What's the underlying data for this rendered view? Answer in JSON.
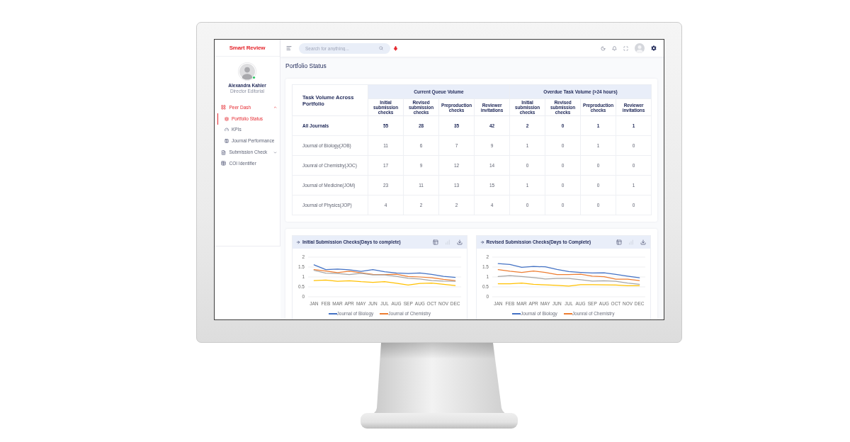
{
  "app": {
    "name": "Smart Review"
  },
  "user": {
    "name": "Alexandra Kahler",
    "role": "Director Editorial",
    "online": true
  },
  "nav": [
    {
      "label": "Peer Dash",
      "selected": true,
      "expanded": true,
      "children": [
        {
          "label": "Portfolio Status",
          "selected": true
        },
        {
          "label": "KPIs",
          "selected": false
        },
        {
          "label": "Journal Performance",
          "selected": false
        }
      ]
    },
    {
      "label": "Submission Check",
      "selected": false,
      "expanded": false
    },
    {
      "label": "COI Identifier",
      "selected": false
    }
  ],
  "search": {
    "placeholder": "Search for anything..."
  },
  "page_title": "Portfolio Status",
  "table": {
    "title": "Task Volume Across Portfolio",
    "groups": [
      {
        "label": "Current Queue Volume",
        "columns": [
          "Initial submission checks",
          "Revised submission checks",
          "Preproduction checks",
          "Reviewer invitations"
        ]
      },
      {
        "label": "Overdue Task Volume (>24 hours)",
        "columns": [
          "Initial submission checks",
          "Revised submission checks",
          "Preproduction checks",
          "Reviewer invitations"
        ]
      }
    ],
    "rows": [
      {
        "kind": "total",
        "name": "All Journals",
        "values": [
          "55",
          "28",
          "35",
          "42",
          "2",
          "0",
          "1",
          "1"
        ]
      },
      {
        "kind": "journal",
        "name": "Journal of Biology(JOB)",
        "values": [
          "11",
          "6",
          "7",
          "9",
          "1",
          "0",
          "1",
          "0"
        ]
      },
      {
        "kind": "journal",
        "name": "Jounral of Chemistry(JOC)",
        "values": [
          "17",
          "9",
          "12",
          "14",
          "0",
          "0",
          "0",
          "0"
        ]
      },
      {
        "kind": "journal",
        "name": "Journal of Medicine(JOM)",
        "values": [
          "23",
          "11",
          "13",
          "15",
          "1",
          "0",
          "0",
          "1"
        ]
      },
      {
        "kind": "journal",
        "name": "Journal of Physics(JOP)",
        "values": [
          "4",
          "2",
          "2",
          "4",
          "0",
          "0",
          "0",
          "0"
        ]
      }
    ]
  },
  "charts": [
    {
      "title": "Initial Submission Checks(Days to complete)",
      "chart_data": {
        "type": "line",
        "grid": true,
        "categories": [
          "JAN",
          "FEB",
          "MAR",
          "APR",
          "MAY",
          "JUN",
          "JUL",
          "AUG",
          "SEP",
          "AUG",
          "OCT",
          "NOV",
          "DEC"
        ],
        "ylim": [
          0,
          2
        ],
        "yticks": [
          0,
          0.5,
          1,
          1.5,
          2
        ],
        "series": [
          {
            "name": "Journal of Biology",
            "color": "#4472c4",
            "values": [
              1.61,
              1.37,
              1.4,
              1.36,
              1.28,
              1.37,
              1.26,
              1.2,
              1.17,
              1.2,
              1.13,
              1.03,
              0.98
            ]
          },
          {
            "name": "Journal of Chemistry",
            "color": "#ed7d31",
            "values": [
              1.37,
              1.3,
              1.22,
              1.29,
              1.21,
              1.13,
              1.12,
              1.14,
              1.02,
              1.0,
              0.96,
              0.88,
              0.82
            ]
          },
          {
            "color": "#a5a5a5",
            "values": [
              1.33,
              1.19,
              1.17,
              1.12,
              1.18,
              1.1,
              1.1,
              1.03,
              0.93,
              0.9,
              0.82,
              0.79,
              0.78
            ]
          },
          {
            "color": "#ffc000",
            "values": [
              0.82,
              0.84,
              0.78,
              0.81,
              0.76,
              0.73,
              0.76,
              0.68,
              0.59,
              0.67,
              0.69,
              0.63,
              0.57
            ]
          }
        ]
      }
    },
    {
      "title": "Revised Submission Checks(Days to Complete)",
      "chart_data": {
        "type": "line",
        "grid": true,
        "categories": [
          "JAN",
          "FEB",
          "MAR",
          "APR",
          "MAY",
          "JUN",
          "JUL",
          "AUG",
          "SEP",
          "AUG",
          "OCT",
          "NOV",
          "DEC"
        ],
        "ylim": [
          0,
          2
        ],
        "yticks": [
          0,
          0.5,
          1,
          1.5,
          2
        ],
        "series": [
          {
            "name": "Journal of Biology",
            "color": "#4472c4",
            "values": [
              1.67,
              1.63,
              1.49,
              1.53,
              1.51,
              1.38,
              1.27,
              1.23,
              1.2,
              1.21,
              1.13,
              1.04,
              0.96
            ]
          },
          {
            "name": "Jounral of Chemistry",
            "color": "#ed7d31",
            "values": [
              1.37,
              1.29,
              1.23,
              1.3,
              1.23,
              1.12,
              1.12,
              1.14,
              1.04,
              1.01,
              0.89,
              0.89,
              0.82
            ]
          },
          {
            "color": "#a5a5a5",
            "values": [
              1.02,
              1.07,
              1.02,
              0.97,
              0.9,
              0.92,
              0.92,
              0.86,
              0.79,
              0.81,
              0.78,
              0.69,
              0.63
            ]
          },
          {
            "color": "#ffc000",
            "values": [
              0.66,
              0.66,
              0.69,
              0.63,
              0.6,
              0.58,
              0.54,
              0.61,
              0.61,
              0.6,
              0.59,
              0.56,
              0.56
            ]
          }
        ]
      }
    }
  ]
}
